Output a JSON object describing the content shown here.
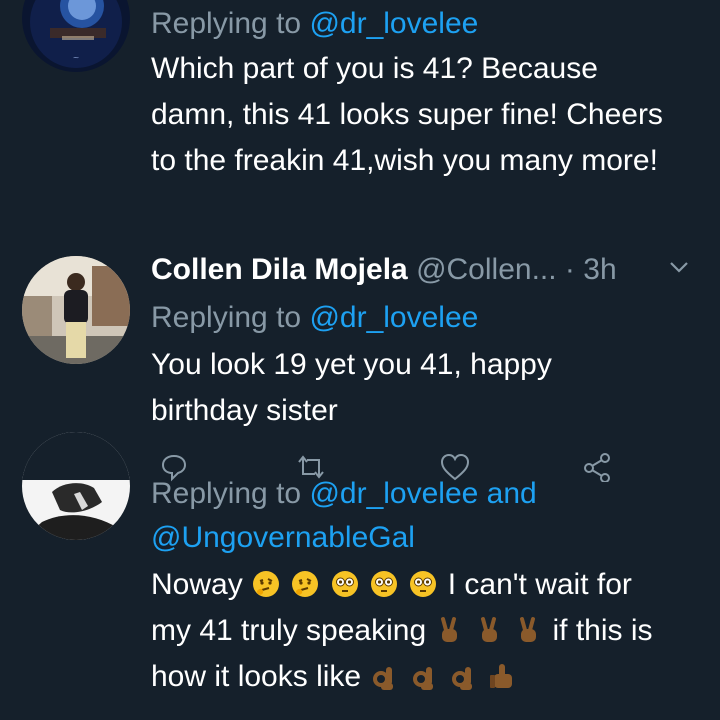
{
  "tweets": [
    {
      "reply_prefix": "Replying to",
      "reply_to": "@dr_lovelee",
      "text": "Which part of you is 41? Because damn, this 41 looks super fine! Cheers to the freakin 41,wish you many more!"
    },
    {
      "name": "Collen Dila Mojela",
      "handle": "@Collen...",
      "separator": "·",
      "time": "3h",
      "reply_prefix": "Replying to",
      "reply_to": "@dr_lovelee",
      "text": "You look 19 yet you 41, happy birthday sister"
    },
    {
      "reply_prefix": "Replying to",
      "reply_to": "@dr_lovelee",
      "reply_and": "and",
      "reply_to_2": "@UngovernableGal",
      "text_1": "Noway",
      "text_2": "I can't wait for my 41 truly speaking",
      "text_3": "if this is how it looks like"
    }
  ],
  "icons": {
    "chevron": "chevron-down-icon",
    "reply": "reply-icon",
    "retweet": "retweet-icon",
    "like": "heart-icon",
    "share": "share-icon"
  },
  "colors": {
    "background": "#15202b",
    "text": "#ffffff",
    "muted": "#8899a6",
    "link": "#1da1f2"
  }
}
